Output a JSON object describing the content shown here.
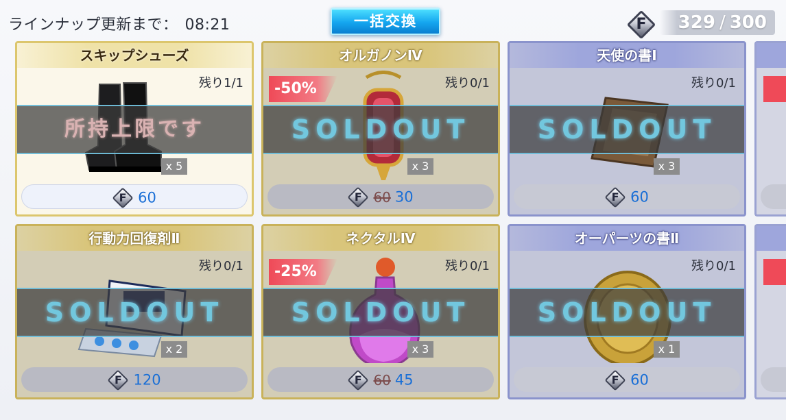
{
  "header": {
    "timer_label": "ラインナップ更新まで：",
    "timer_value": "08:21",
    "bulk_exchange_label": "一括交換",
    "currency_symbol": "F",
    "currency_owned": "329",
    "currency_separator": "/",
    "currency_max": "300"
  },
  "items": [
    {
      "name": "スキップシューズ",
      "remaining": "残り1/1",
      "discount": "",
      "quantity": "x 5",
      "overlay": "所持上限です",
      "old_price": "",
      "price": "60",
      "rarity": "gold"
    },
    {
      "name": "オルガノンⅣ",
      "remaining": "残り0/1",
      "discount": "-50%",
      "quantity": "x 3",
      "overlay": "SOLDOUT",
      "old_price": "60",
      "price": "30",
      "rarity": "gold"
    },
    {
      "name": "天使の書Ⅰ",
      "remaining": "残り0/1",
      "discount": "",
      "quantity": "x 3",
      "overlay": "SOLDOUT",
      "old_price": "",
      "price": "60",
      "rarity": "blue"
    },
    {
      "name": "行動力回復剤Ⅱ",
      "remaining": "残り0/1",
      "discount": "",
      "quantity": "x 2",
      "overlay": "SOLDOUT",
      "old_price": "",
      "price": "120",
      "rarity": "gold"
    },
    {
      "name": "ネクタルⅣ",
      "remaining": "残り0/1",
      "discount": "-25%",
      "quantity": "x 3",
      "overlay": "SOLDOUT",
      "old_price": "60",
      "price": "45",
      "rarity": "gold"
    },
    {
      "name": "オーパーツの書Ⅱ",
      "remaining": "残り0/1",
      "discount": "",
      "quantity": "x 1",
      "overlay": "SOLDOUT",
      "old_price": "",
      "price": "60",
      "rarity": "blue"
    }
  ],
  "item_icons": [
    "boots-icon",
    "lantern-icon",
    "scroll-icon",
    "pill-box-icon",
    "potion-bottle-icon",
    "gold-coin-icon"
  ],
  "colors": {
    "gold_border": "#c9b25a",
    "blue_border": "#8a93cc",
    "discount_red": "#ef4a58",
    "price_blue": "#1a6fd6",
    "soldout_cyan": "#72c7de",
    "button_cyan": "#14a6ef"
  }
}
